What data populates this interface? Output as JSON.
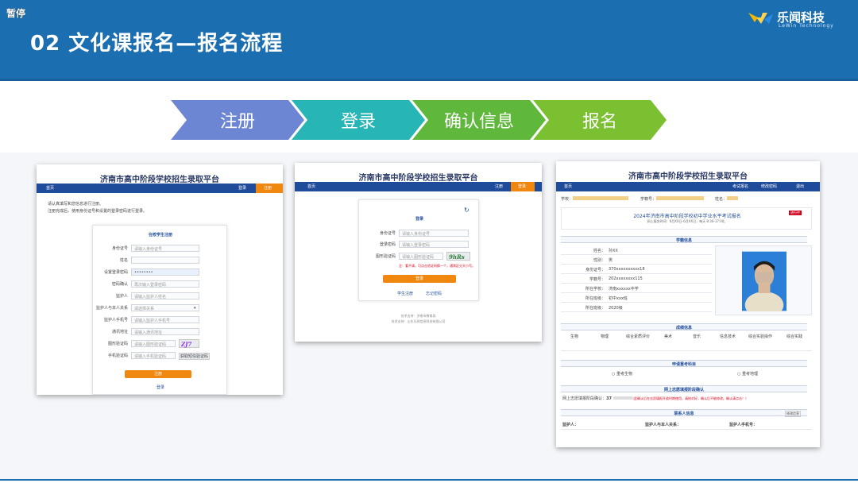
{
  "header": {
    "paused_label": "暂停",
    "title": "02 文化课报名—报名流程",
    "logo_cn": "乐闻科技",
    "logo_en": "LeWin Technology",
    "logo_icon": "lewin-logo-icon"
  },
  "steps": [
    {
      "label": "注册",
      "color": "#6d86d4"
    },
    {
      "label": "登录",
      "color": "#27b5b5"
    },
    {
      "label": "确认信息",
      "color": "#5fb83b"
    },
    {
      "label": "报名",
      "color": "#7bc031"
    }
  ],
  "shot1": {
    "title": "济南市高中阶段学校招生录取平台",
    "nav_home": "首页",
    "nav_login": "登录",
    "nav_register": "注册",
    "notice1": "请认真填写和您信息进行注册。",
    "notice2": "注册完成后，使用身份证号和设置的登录密码进行登录。",
    "form_title": "在校学生注册",
    "fields": [
      {
        "label": "身份证号",
        "placeholder": "请输入身份证号"
      },
      {
        "label": "姓名",
        "placeholder": ""
      },
      {
        "label": "设置登录密码",
        "placeholder": "••••••••"
      },
      {
        "label": "密码确认",
        "placeholder": "再次输入登录密码"
      },
      {
        "label": "监护人",
        "placeholder": "请输入监护人姓名"
      },
      {
        "label": "监护人与本人关系",
        "placeholder": "请选择关系"
      },
      {
        "label": "监护人手机号",
        "placeholder": "请输入监护人手机号"
      },
      {
        "label": "通讯地址",
        "placeholder": "请输入通讯地址"
      },
      {
        "label": "图形验证码",
        "placeholder": "请输入图形验证码"
      },
      {
        "label": "手机验证码",
        "placeholder": "请输入手机验证码"
      }
    ],
    "captcha": "ZJ7",
    "sms_button": "获取短信验证码",
    "register_button": "注册",
    "login_link": "登录"
  },
  "shot2": {
    "title": "济南市高中阶段学校招生录取平台",
    "nav_home": "首页",
    "nav_register": "注册",
    "nav_login": "登录",
    "form_title": "登录",
    "fields": [
      {
        "label": "身份证号",
        "placeholder": "请输入身份证号"
      },
      {
        "label": "登录密码",
        "placeholder": "请输入登录密码"
      },
      {
        "label": "图形验证码",
        "placeholder": "请输入图形验证码"
      }
    ],
    "captcha": "9hRs",
    "tip": "注：看不清，可点击验证码换一个，通常区分大小写。",
    "login_button": "登录",
    "link_register": "学生注册",
    "link_forgot": "忘记密码",
    "footer1": "技术支持：济南市教育局",
    "footer2": "技术支持：山东乐闻信息科技有限公司"
  },
  "shot3": {
    "title": "济南市高中阶段学校招生录取平台",
    "nav_home": "首页",
    "nav_items": [
      "考试报名",
      "修改密码",
      "退出"
    ],
    "info_school_label": "学校：",
    "info_no_label": "学籍号：",
    "info_name_label": "姓名：",
    "exam_title": "2024年济南市高中阶段学校初中学业水平考试报名",
    "exam_sub": "网上报名时间：6月XX日-6月XX日，每天 8:30-17:00。",
    "status_badge": "进行中",
    "sec_student": "学籍信息",
    "student_rows": [
      {
        "label": "姓名：",
        "value": "孙XX"
      },
      {
        "label": "性别：",
        "value": "男"
      },
      {
        "label": "身份证号：",
        "value": "370xxxxxxxxxx18"
      },
      {
        "label": "学籍号：",
        "value": "202xxxxxxxx115"
      },
      {
        "label": "所在学校：",
        "value": "济南xxxxxx中学"
      },
      {
        "label": "所在班级：",
        "value": "初中xxx班"
      },
      {
        "label": "所在班级：",
        "value": "2020级"
      }
    ],
    "sec_scores": "成绩信息",
    "score_cols": [
      "生物",
      "物理",
      "综合素质评价",
      "美术",
      "音乐",
      "信息技术",
      "综合实验操作",
      "综合实践"
    ],
    "sec_apply": "申请重考科目",
    "apply_opt1": "重考生物",
    "apply_opt2": "重考地理",
    "sec_confirm": "网上志愿填报阶段确认",
    "confirm_label": "网上志愿填报阶段确认：",
    "confirm_value": "37",
    "confirm_tip": "（此确认后在志愿填报开放时期使用，请核对好，确认后不能修改。确认请点击！）",
    "sec_contact": "联系人信息",
    "edit_contact": "修改信息",
    "contact_labels": [
      "监护人：",
      "监护人与本人关系：",
      "监护人手机号："
    ]
  }
}
